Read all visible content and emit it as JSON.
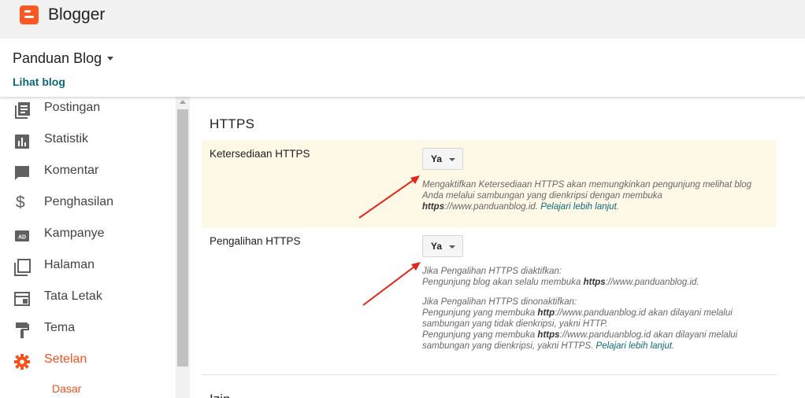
{
  "app": {
    "title": "Blogger",
    "logo_icon": "blogger-logo-icon",
    "brand_color": "#ff5722"
  },
  "blog": {
    "name": "Panduan Blog",
    "view_label": "Lihat blog"
  },
  "sidebar": {
    "items": [
      {
        "label": "Postingan",
        "icon": "posts-icon"
      },
      {
        "label": "Statistik",
        "icon": "stats-icon"
      },
      {
        "label": "Komentar",
        "icon": "comment-icon"
      },
      {
        "label": "Penghasilan",
        "icon": "dollar-icon"
      },
      {
        "label": "Kampanye",
        "icon": "ad-icon"
      },
      {
        "label": "Halaman",
        "icon": "pages-icon"
      },
      {
        "label": "Tata Letak",
        "icon": "layout-icon"
      },
      {
        "label": "Tema",
        "icon": "paint-roller-icon"
      },
      {
        "label": "Setelan",
        "icon": "gear-icon",
        "active": true
      }
    ],
    "sub_item": "Dasar",
    "active_color": "#f4511e"
  },
  "main": {
    "section_title": "HTTPS",
    "availability": {
      "label": "Ketersediaan HTTPS",
      "value": "Ya",
      "help_line1": "Mengaktifkan Ketersediaan HTTPS akan memungkinkan pengunjung melihat blog",
      "help_line2": "Anda melalui sambungan yang dienkripsi dengan membuka",
      "help_url_bold": "https",
      "help_url_rest": "://www.panduanblog.id.",
      "help_link": "Pelajari lebih lanjut",
      "help_end": "."
    },
    "redirect": {
      "label": "Pengalihan HTTPS",
      "value": "Ya",
      "on_title": "Jika Pengalihan HTTPS diaktifkan:",
      "on_line_a": "Pengunjung blog akan selalu membuka",
      "on_url_bold": "https",
      "on_url_rest": "://www.panduanblog.id.",
      "off_title": "Jika Pengalihan HTTPS dinonaktifkan:",
      "off_l1a": "Pengunjung yang membuka",
      "off_l1_bold": "http",
      "off_l1b": "://www.panduanblog.id akan dilayani melalui",
      "off_l2": "sambungan yang tidak dienkripsi, yakni HTTP.",
      "off_l3a": "Pengunjung yang membuka",
      "off_l3_bold": "https",
      "off_l3b": "://www.panduanblog.id akan dilayani melalui",
      "off_l4": "sambungan yang dienkripsi, yakni HTTPS.",
      "help_link": "Pelajari lebih lanjut",
      "help_end": "."
    },
    "next_section_title": "Izin",
    "highlight_color": "#fef9e7",
    "link_color": "#0e6875",
    "arrow_color": "#e3261c"
  }
}
